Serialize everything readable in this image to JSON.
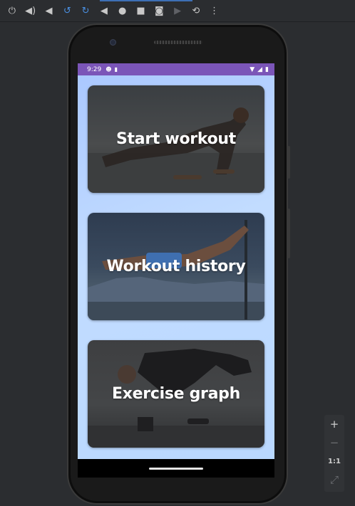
{
  "toolbar": {
    "buttons": [
      {
        "name": "power-icon",
        "glyph": "⏻"
      },
      {
        "name": "volume-up-icon",
        "glyph": "🔊"
      },
      {
        "name": "volume-down-icon",
        "glyph": "🔉"
      },
      {
        "name": "rotate-left-icon",
        "glyph": "⟲"
      },
      {
        "name": "rotate-right-icon",
        "glyph": "⟳"
      },
      {
        "name": "back-icon",
        "glyph": "◀"
      },
      {
        "name": "home-icon",
        "glyph": "●"
      },
      {
        "name": "overview-icon",
        "glyph": "■"
      },
      {
        "name": "screenshot-icon",
        "glyph": "📷"
      },
      {
        "name": "screenrecord-icon",
        "glyph": "🎥"
      },
      {
        "name": "snapshot-icon",
        "glyph": "⟲"
      },
      {
        "name": "more-icon",
        "glyph": "⋮"
      }
    ]
  },
  "status_bar": {
    "time": "9:29",
    "icons": [
      "android-icon",
      "sd-card-icon"
    ],
    "right_icons": [
      "wifi-icon",
      "signal-icon",
      "battery-icon"
    ]
  },
  "cards": [
    {
      "label": "Start workout"
    },
    {
      "label": "Workout history"
    },
    {
      "label": "Exercise graph"
    }
  ],
  "zoom": {
    "zoom_in": "+",
    "zoom_out": "−",
    "actual_size": "1:1",
    "fit": "⤢"
  },
  "colors": {
    "accent_status": "#7b55b8",
    "screen_bg": "#b9d8ff",
    "ide_bg": "#2b2d30"
  }
}
